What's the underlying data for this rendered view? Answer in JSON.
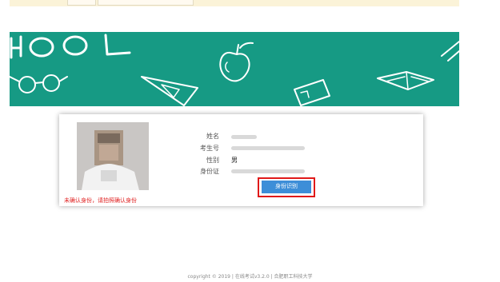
{
  "banner": {
    "text_fragment": "HOOL"
  },
  "profile": {
    "photo_alt": "",
    "warning": "未确认身份，请拍照确认身份",
    "fields": [
      {
        "label": "姓名",
        "value": ""
      },
      {
        "label": "考生号",
        "value": ""
      },
      {
        "label": "性别",
        "value": "男"
      },
      {
        "label": "身份证",
        "value": ""
      }
    ],
    "verify_button": "身份识别"
  },
  "footer": {
    "text": "copyright © 2019 | 在线考试v3.2.0 | 合肥职工科技大学"
  },
  "colors": {
    "banner_bg": "#169a84",
    "button_bg": "#3d8ed8",
    "highlight": "#e01919",
    "warning": "#e02020"
  }
}
